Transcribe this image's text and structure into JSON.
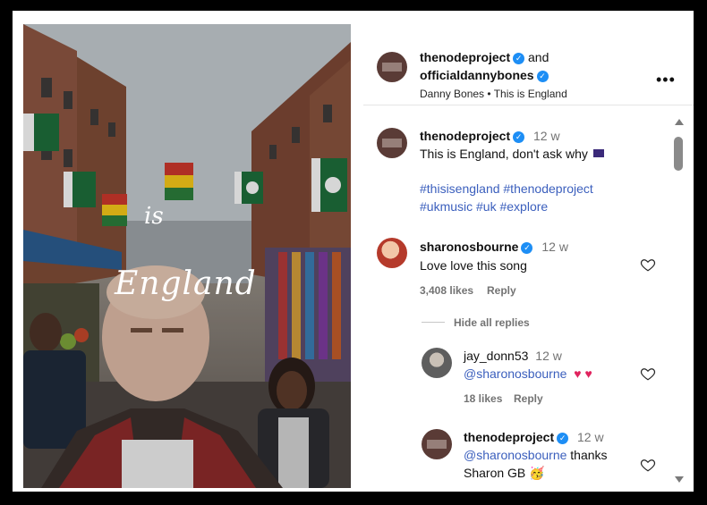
{
  "media": {
    "overlay_is": "is",
    "overlay_england": "England"
  },
  "header": {
    "user1": "thenodeproject",
    "joiner": "and",
    "user2": "officialdannybones",
    "subtitle": "Danny Bones • This is England",
    "more_icon": "more-horizontal-icon"
  },
  "caption": {
    "username": "thenodeproject",
    "time": "12 w",
    "text": "This is England, don't ask why",
    "emoji": "flag",
    "hashtags_line1": "#thisisengland  #thenodeproject",
    "hashtags_line2": "#ukmusic #uk #explore"
  },
  "comments": [
    {
      "username": "sharonosbourne",
      "time": "12 w",
      "text": "Love love this song",
      "likes": "3,408 likes",
      "reply": "Reply",
      "hide_replies": "Hide all replies"
    }
  ],
  "replies": [
    {
      "username": "jay_donn53",
      "time": "12 w",
      "mention": "@sharonosbourne",
      "emoji": "♥ ♥",
      "likes": "18 likes",
      "reply": "Reply"
    },
    {
      "username": "thenodeproject",
      "time": "12 w",
      "mention": "@sharonosbourne",
      "text_after": "thanks",
      "text_line2": "Sharon GB 🥳"
    }
  ],
  "colors": {
    "verified": "#1d8ef5",
    "hashtag": "#3b5fbd",
    "muted": "#737373"
  }
}
